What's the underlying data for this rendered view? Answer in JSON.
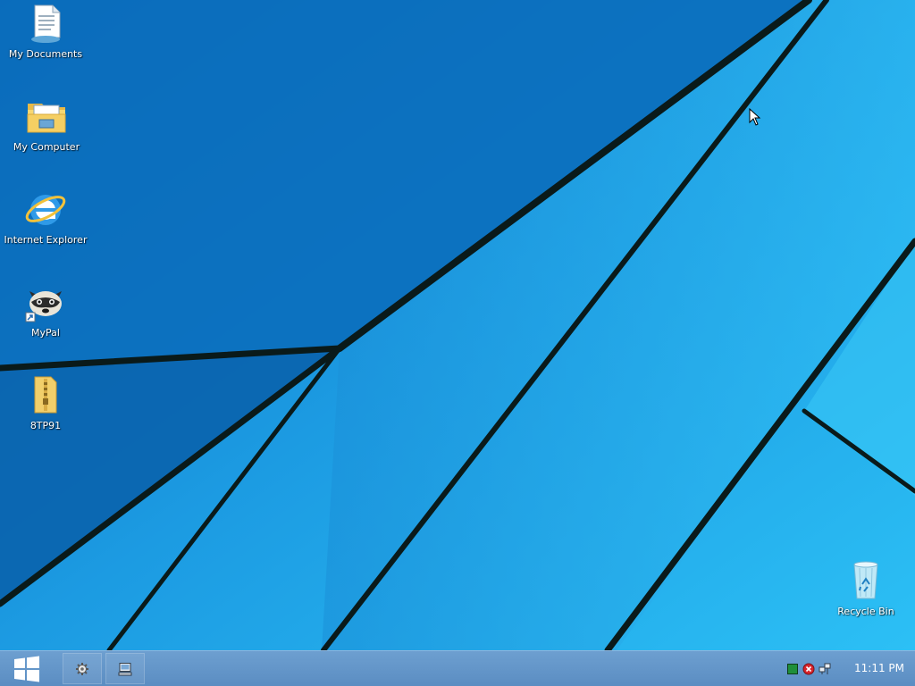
{
  "desktop": {
    "icons": [
      {
        "label": "My Documents",
        "icon": "document-icon"
      },
      {
        "label": "My Computer",
        "icon": "folder-computer-icon"
      },
      {
        "label": "Internet Explorer",
        "icon": "internet-explorer-icon"
      },
      {
        "label": "MyPal",
        "icon": "mypal-raccoon-icon"
      },
      {
        "label": "8TP91",
        "icon": "zip-folder-icon"
      }
    ],
    "recycle_bin": {
      "label": "Recycle Bin",
      "icon": "recycle-bin-icon"
    }
  },
  "taskbar": {
    "start_icon": "windows-logo-icon",
    "buttons": [
      {
        "icon": "settings-gear-icon"
      },
      {
        "icon": "computer-window-icon"
      }
    ],
    "tray": [
      {
        "icon": "green-status-icon"
      },
      {
        "icon": "network-error-icon"
      },
      {
        "icon": "network-icon"
      }
    ],
    "clock": "11:11 PM"
  },
  "colors": {
    "wallpaper_light": "#27b8f2",
    "wallpaper_dark": "#0a68b8",
    "taskbar": "#6395c9"
  }
}
